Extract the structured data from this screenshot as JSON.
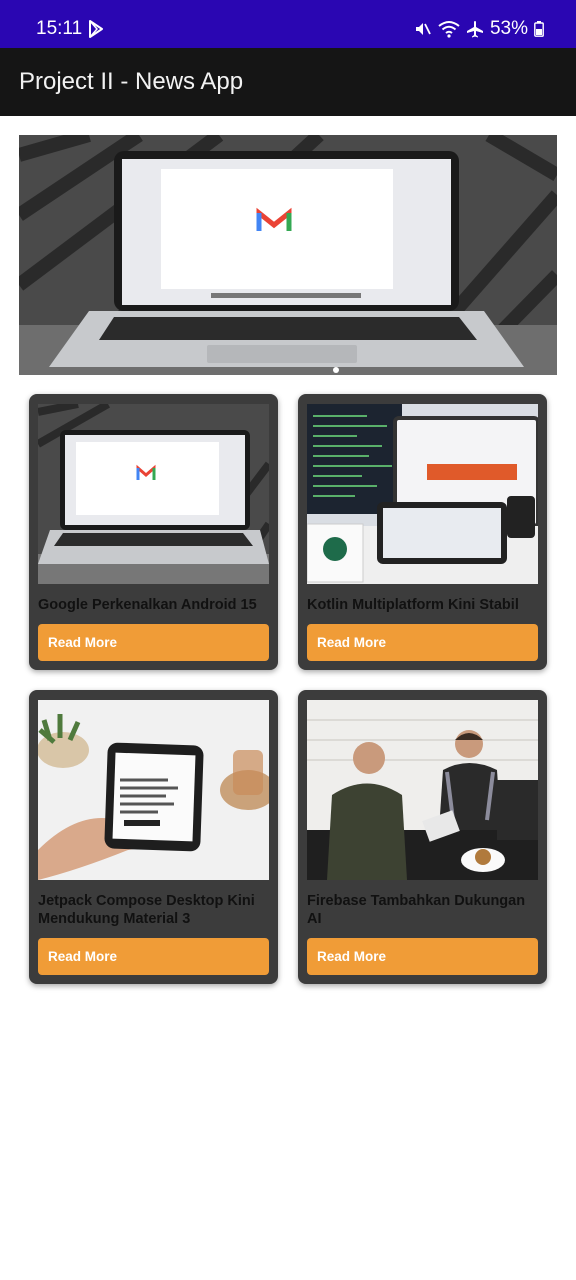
{
  "status": {
    "time": "15:11",
    "battery": "53%"
  },
  "app": {
    "title": "Project II - News App"
  },
  "banner": {
    "image": "laptop-gmail-image"
  },
  "articles": [
    {
      "title": "Google Perkenalkan Android 15",
      "button": "Read More",
      "image": "laptop-gmail-image"
    },
    {
      "title": "Kotlin Multiplatform Kini Stabil",
      "button": "Read More",
      "image": "devices-desk-image"
    },
    {
      "title": "Jetpack Compose Desktop Kini Mendukung Material 3",
      "button": "Read More",
      "image": "phone-in-hand-image"
    },
    {
      "title": "Firebase Tambahkan Dukungan AI",
      "button": "Read More",
      "image": "cafe-counter-image"
    }
  ]
}
